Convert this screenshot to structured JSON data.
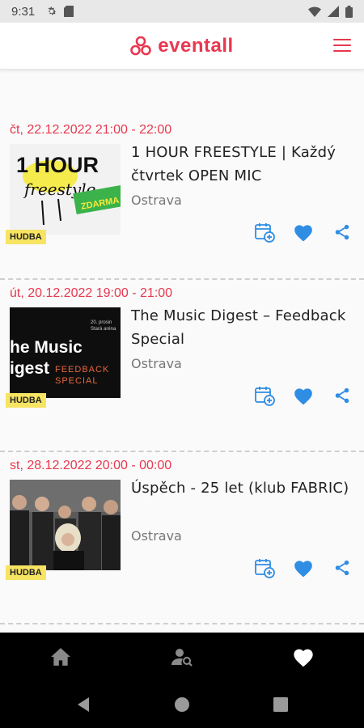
{
  "status_bar": {
    "time": "9:31"
  },
  "app": {
    "logo_text": "eventall",
    "brand_color": "#e8384f"
  },
  "events": [
    {
      "date": "čt, 22.12.2022 21:00 - 22:00",
      "title": "1 HOUR FREESTYLE | Každý čtvrtek OPEN MIC",
      "city": "Ostrava",
      "tag": "HUDBA",
      "thumb_text": "1 HOUR",
      "thumb_subtext": "freestyle",
      "thumb_badge": "ZDARMA"
    },
    {
      "date": "út, 20.12.2022 19:00 - 21:00",
      "title": "The Music Digest – Feedback Special",
      "city": "Ostrava",
      "tag": "HUDBA",
      "thumb_text_1": "he Music",
      "thumb_text_2": "igest",
      "thumb_side_1": "FEEDBACK",
      "thumb_side_2": "SPECIAL",
      "thumb_corner_1": "20. prosin",
      "thumb_corner_2": "Stará aréna"
    },
    {
      "date": "st, 28.12.2022 20:00 - 00:00",
      "title": "Úspěch - 25 let (klub FABRIC)",
      "city": "Ostrava",
      "tag": "HUDBA"
    }
  ],
  "icons": {
    "calendar_add": "calendar-add-icon",
    "favorite": "heart-icon",
    "share": "share-icon",
    "home": "home-icon",
    "user_search": "user-search-icon",
    "favorites": "heart-icon"
  },
  "colors": {
    "action_blue": "#2f8de4",
    "tag_yellow": "#f7e463",
    "date_red": "#e8384f"
  }
}
